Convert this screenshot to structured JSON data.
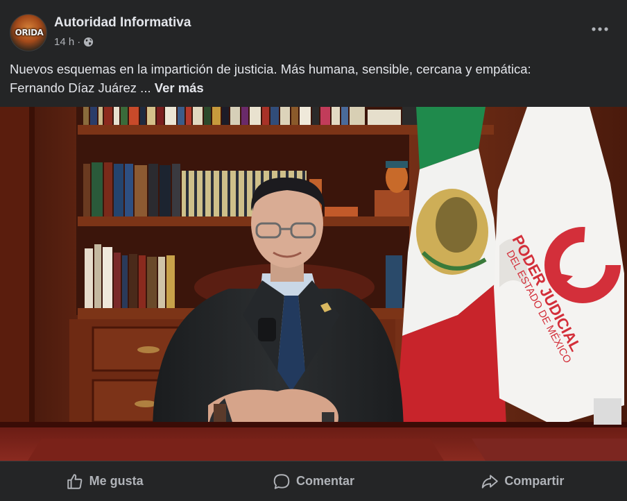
{
  "post": {
    "author": "Autoridad Informativa",
    "avatar_text": "ORIDA",
    "time": "14 h",
    "separator": "·",
    "privacy_icon": "globe-icon",
    "more_icon": "more-options-icon",
    "text_line1": "Nuevos esquemas en la impartición de justicia. Más humana, sensible, cercana y empática:",
    "text_line2": "Fernando Díaz Juárez",
    "ellipsis": " ... ",
    "see_more": "Ver más"
  },
  "image": {
    "banner_line1": "PODER JUDICIAL",
    "banner_line2": "DEL ESTADO DE MÉXICO",
    "colors": {
      "wood": "#6b2a14",
      "flag_green": "#1f8a4c",
      "flag_white": "#f2f2f0",
      "flag_red": "#c8242b",
      "logo_red": "#d32f3a",
      "suit": "#222426",
      "tie": "#223a5e"
    }
  },
  "actions": {
    "like": "Me gusta",
    "comment": "Comentar",
    "share": "Compartir"
  }
}
